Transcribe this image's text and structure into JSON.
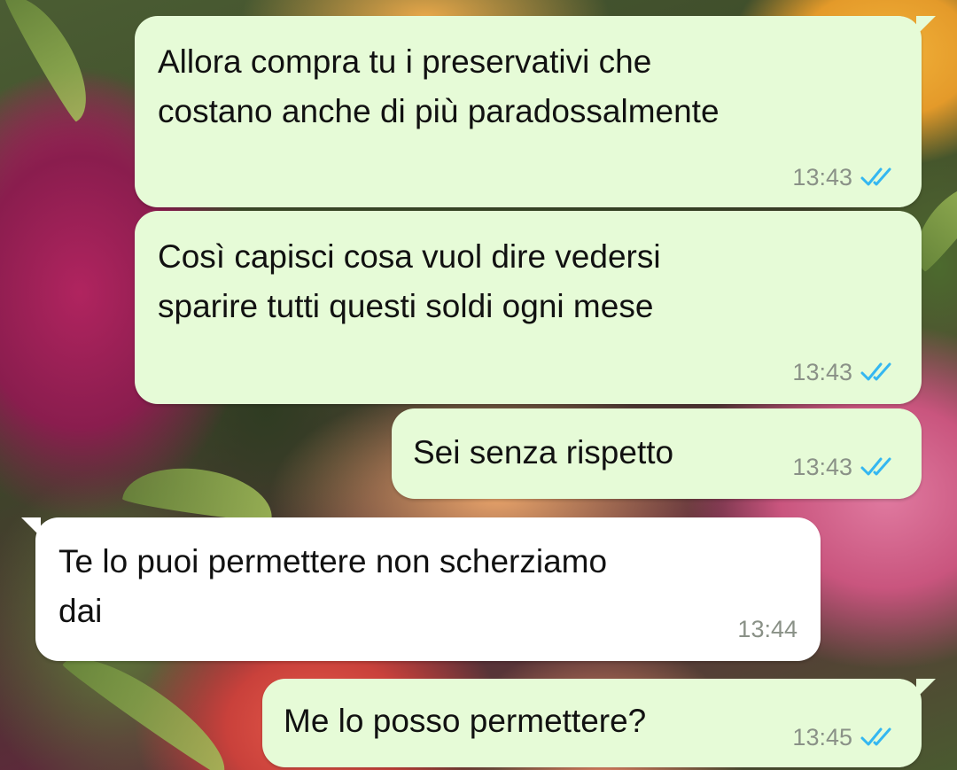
{
  "theme": {
    "outgoing_bubble": "#e6fbd7",
    "incoming_bubble": "#ffffff",
    "text_color": "#111111",
    "time_color": "#8a9187",
    "read_tick_color": "#34b7f1"
  },
  "messages": [
    {
      "direction": "outgoing",
      "text": "Allora compra tu i preservativi che\ncostano anche di più paradossalmente",
      "time": "13:43",
      "status_icon": "double-check-read-icon"
    },
    {
      "direction": "outgoing",
      "text": "Così capisci cosa vuol dire vedersi\nsparire tutti questi soldi ogni mese",
      "time": "13:43",
      "status_icon": "double-check-read-icon"
    },
    {
      "direction": "outgoing",
      "text": "Sei senza rispetto",
      "time": "13:43",
      "status_icon": "double-check-read-icon"
    },
    {
      "direction": "incoming",
      "text": "Te lo puoi permettere non scherziamo\ndai",
      "time": "13:44"
    },
    {
      "direction": "outgoing",
      "text": "Me lo posso permettere?",
      "time": "13:45",
      "status_icon": "double-check-read-icon"
    }
  ]
}
